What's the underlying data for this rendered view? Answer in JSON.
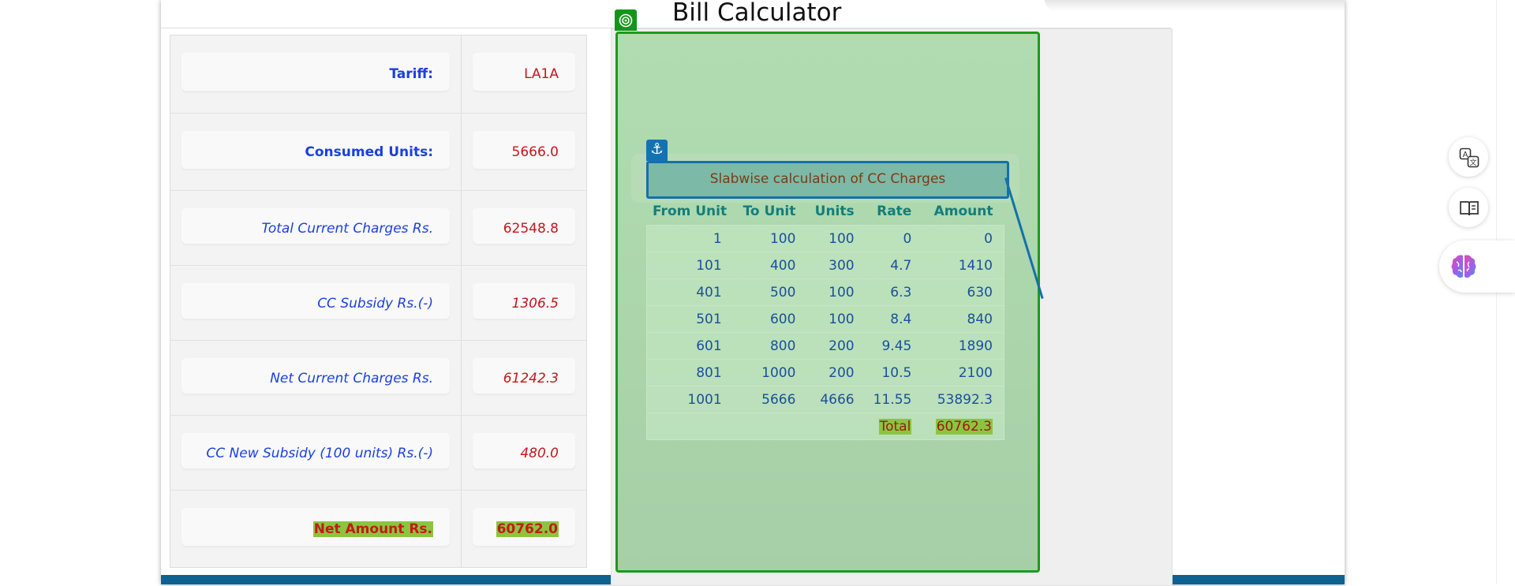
{
  "page": {
    "title": "Bill Calculator"
  },
  "summary": [
    {
      "label": "Tariff:",
      "value": "LA1A",
      "style": "bold"
    },
    {
      "label": "Consumed Units:",
      "value": "5666.0",
      "style": "bold"
    },
    {
      "label": "Total Current Charges Rs.",
      "value": "62548.8",
      "style": "italic"
    },
    {
      "label": "CC Subsidy Rs.(-)",
      "value": "1306.5",
      "style": "italic"
    },
    {
      "label": "Net Current Charges Rs.",
      "value": "61242.3",
      "style": "italic"
    },
    {
      "label": "CC New Subsidy (100 units) Rs.(-)",
      "value": "480.0",
      "style": "italic"
    },
    {
      "label": "Net Amount Rs.",
      "value": "60762.0",
      "style": "highlight"
    }
  ],
  "slabwise": {
    "title": "Slabwise calculation of CC Charges",
    "headers": [
      "From Unit",
      "To Unit",
      "Units",
      "Rate",
      "Amount"
    ],
    "rows": [
      [
        "1",
        "100",
        "100",
        "0",
        "0"
      ],
      [
        "101",
        "400",
        "300",
        "4.7",
        "1410"
      ],
      [
        "401",
        "500",
        "100",
        "6.3",
        "630"
      ],
      [
        "501",
        "600",
        "100",
        "8.4",
        "840"
      ],
      [
        "601",
        "800",
        "200",
        "9.45",
        "1890"
      ],
      [
        "801",
        "1000",
        "200",
        "10.5",
        "2100"
      ],
      [
        "1001",
        "5666",
        "4666",
        "11.55",
        "53892.3"
      ]
    ],
    "total_label": "Total",
    "total_value": "60762.3"
  },
  "float_icons": [
    "translate-icon",
    "reader-icon",
    "brain-icon"
  ],
  "colors": {
    "label_blue": "#1a3fe0",
    "value_red": "#c5161d",
    "highlight_green": "#8bc53f",
    "panel_green": "#b1dcb1",
    "panel_border": "#1b9b1b",
    "footer_blue": "#0e6292"
  }
}
